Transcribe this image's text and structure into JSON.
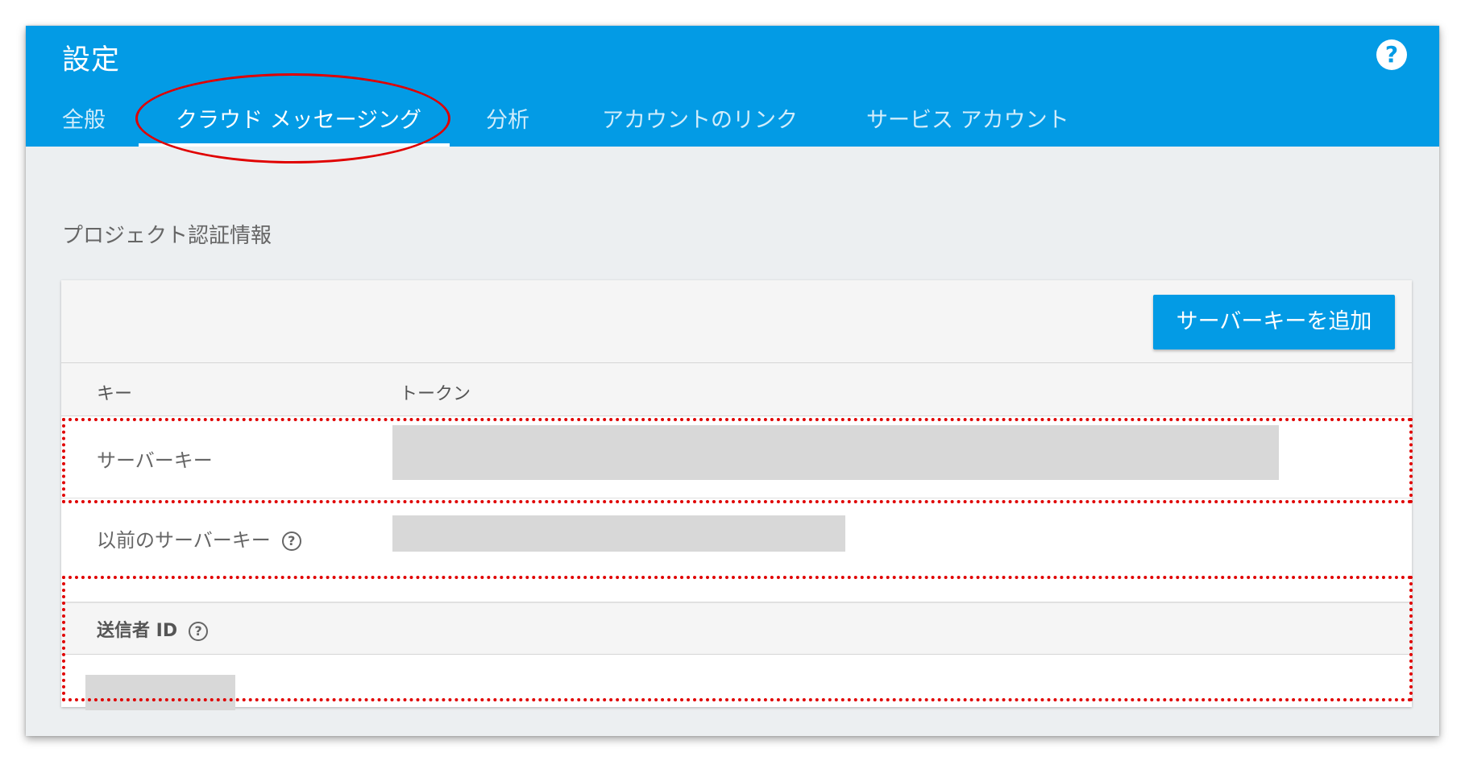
{
  "header": {
    "title": "設定",
    "help_icon": "question-circle-icon",
    "help_glyph": "?"
  },
  "tabs": [
    {
      "label": "全般",
      "active": false
    },
    {
      "label": "クラウド メッセージング",
      "active": true
    },
    {
      "label": "分析",
      "active": false
    },
    {
      "label": "アカウントのリンク",
      "active": false
    },
    {
      "label": "サービス アカウント",
      "active": false
    }
  ],
  "section": {
    "title": "プロジェクト認証情報"
  },
  "card": {
    "add_button_label": "サーバーキーを追加",
    "columns": [
      "キー",
      "トークン"
    ],
    "rows": [
      {
        "label": "サーバーキー",
        "token": ""
      },
      {
        "label": "以前のサーバーキー",
        "token": "",
        "help_glyph": "?"
      }
    ],
    "sender": {
      "label": "送信者 ID",
      "help_glyph": "?",
      "value": ""
    }
  },
  "colors": {
    "header_blue": "#039be5",
    "annotation_red": "#e00000",
    "background": "#eceff1",
    "redacted": "#d8d8d8"
  }
}
